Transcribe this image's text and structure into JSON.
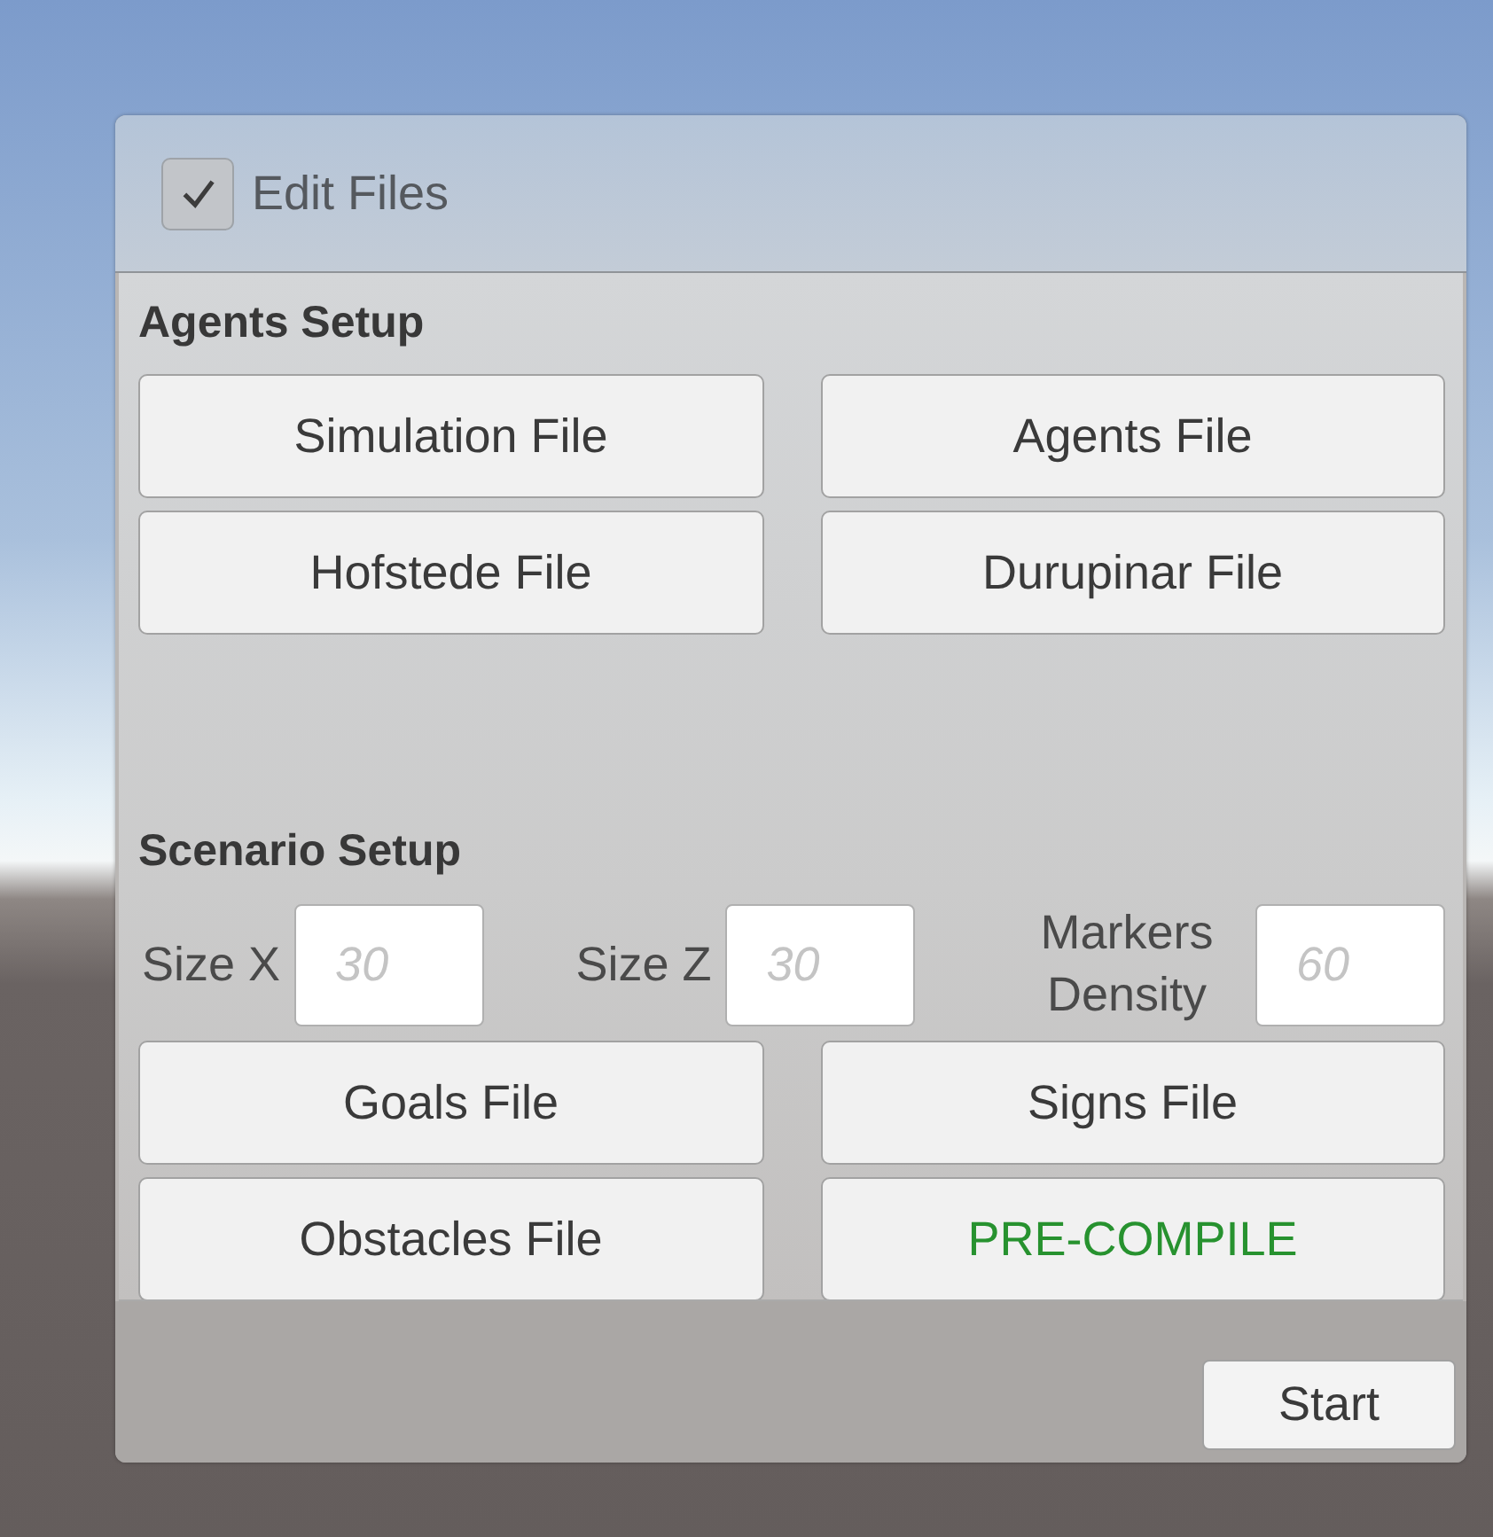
{
  "edit_files": {
    "label": "Edit Files",
    "checked": true
  },
  "sections": [
    {
      "title": "Agents Setup",
      "buttons": [
        {
          "label": "Simulation File",
          "kind": "file"
        },
        {
          "label": "Agents File",
          "kind": "file"
        },
        {
          "label": "Hofstede File",
          "kind": "file"
        },
        {
          "label": "Durupinar File",
          "kind": "file"
        }
      ]
    },
    {
      "title": "Scenario Setup",
      "fields": [
        {
          "label": "Size X",
          "placeholder": "30"
        },
        {
          "label": "Size Z",
          "placeholder": "30"
        },
        {
          "label": "Markers Density",
          "placeholder": "60"
        }
      ],
      "buttons": [
        {
          "label": "Goals File",
          "kind": "file"
        },
        {
          "label": "Signs File",
          "kind": "file"
        },
        {
          "label": "Obstacles File",
          "kind": "file"
        },
        {
          "label": "PRE-COMPILE",
          "kind": "compile"
        }
      ]
    }
  ],
  "start_button": "Start"
}
